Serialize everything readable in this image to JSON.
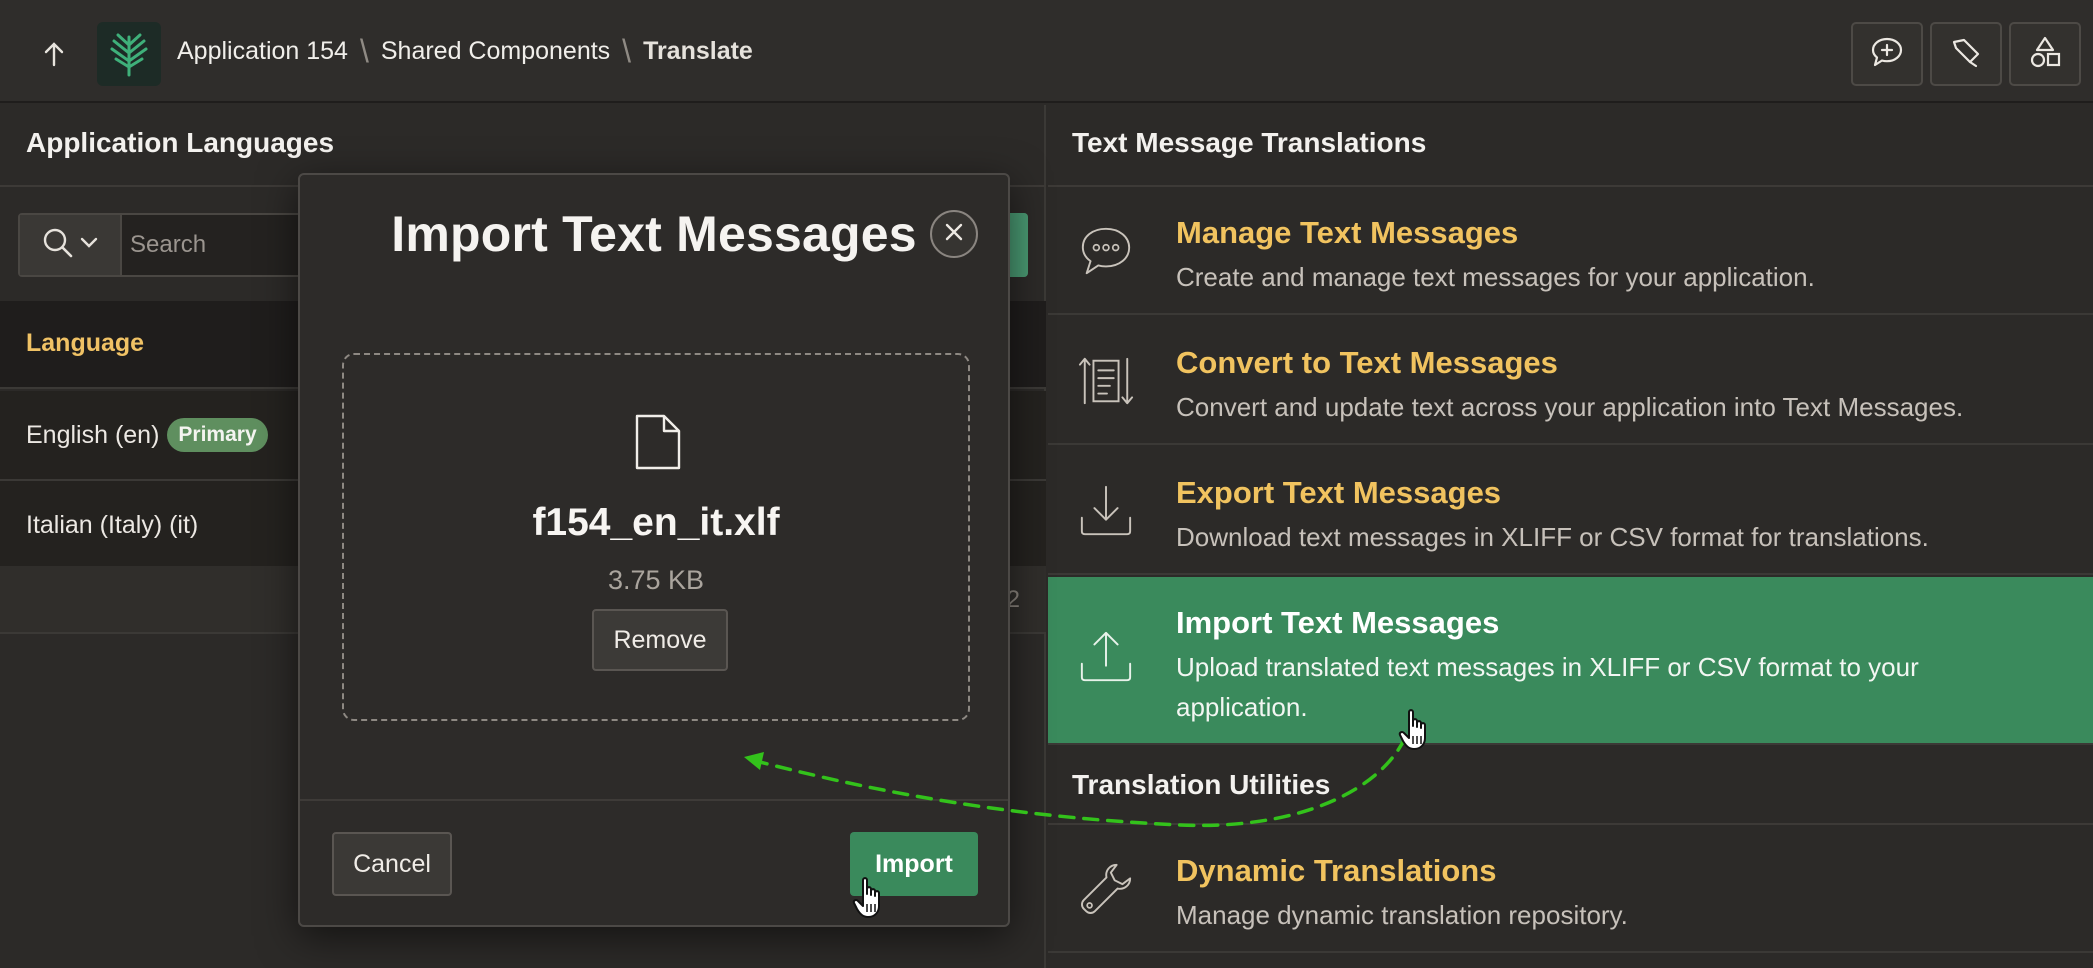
{
  "header": {
    "breadcrumb": [
      "Application 154",
      "Shared Components",
      "Translate"
    ],
    "icons": [
      "arrow-up-icon",
      "tree-logo-icon",
      "chat-plus-icon",
      "brush-icon",
      "shapes-icon"
    ]
  },
  "left_panel": {
    "title": "Application Languages",
    "search": {
      "placeholder": "Search",
      "value": ""
    },
    "table": {
      "headers": [
        "Language"
      ],
      "rows": [
        {
          "language": "English (en)",
          "badge": "Primary"
        },
        {
          "language": "Italian (Italy) (it)",
          "badge": ""
        }
      ],
      "row_count": "2"
    }
  },
  "right_panel": {
    "title": "Text Message Translations",
    "items": [
      {
        "title": "Manage Text Messages",
        "desc": "Create and manage text messages for your application.",
        "icon": "chat-bubble-icon"
      },
      {
        "title": "Convert to Text Messages",
        "desc": "Convert and update text across your application into Text Messages.",
        "icon": "convert-list-icon"
      },
      {
        "title": "Export Text Messages",
        "desc": "Download text messages in XLIFF or CSV format for translations.",
        "icon": "download-icon"
      },
      {
        "title": "Import Text Messages",
        "desc": "Upload translated text messages in XLIFF or CSV format to your application.",
        "icon": "upload-icon"
      }
    ],
    "utilities_title": "Translation Utilities",
    "utilities": [
      {
        "title": "Dynamic Translations",
        "desc": "Manage dynamic translation repository.",
        "icon": "wrench-icon"
      }
    ]
  },
  "modal": {
    "title": "Import Text Messages",
    "file": {
      "name": "f154_en_it.xlf",
      "size": "3.75 KB"
    },
    "remove_label": "Remove",
    "cancel_label": "Cancel",
    "import_label": "Import"
  },
  "colors": {
    "accent_green": "#3a8a5c",
    "link_yellow": "#f1c35f",
    "background": "#2c2a28",
    "arrow_annotation": "#33c21b"
  }
}
